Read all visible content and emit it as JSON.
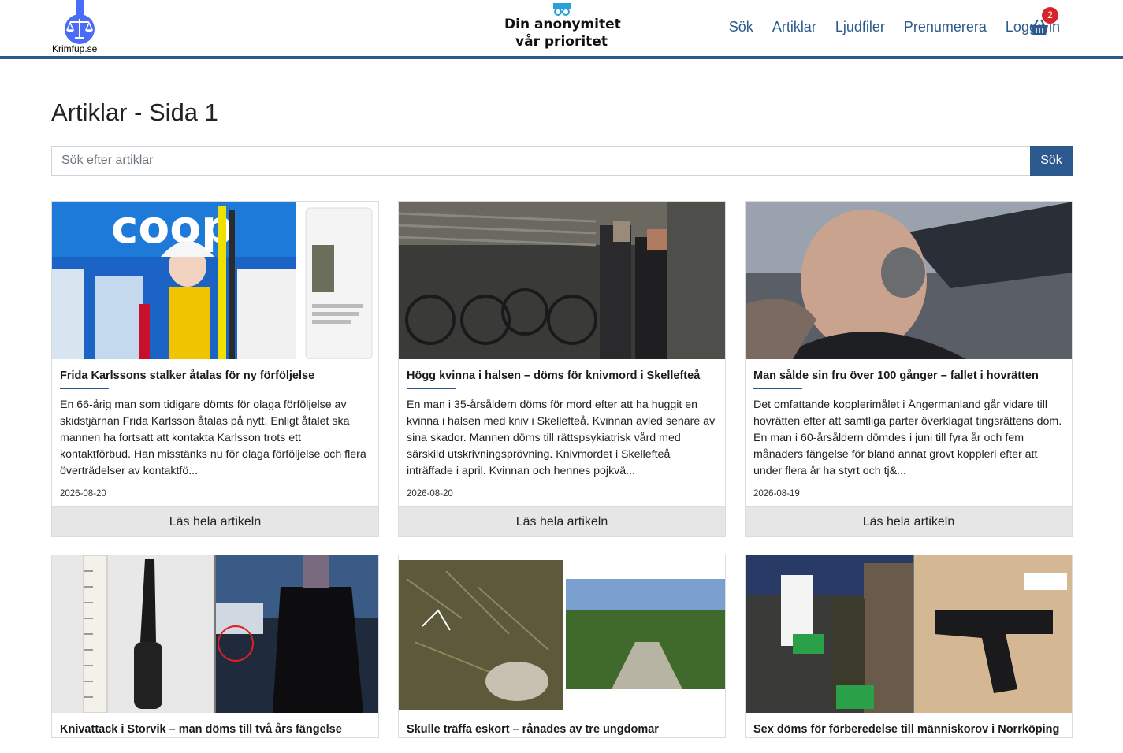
{
  "header": {
    "logo_text": "Krimfup.se",
    "slogan_line1": "Din anonymitet",
    "slogan_line2": "vår prioritet",
    "nav": [
      "Sök",
      "Artiklar",
      "Ljudfiler",
      "Prenumerera",
      "Logga in"
    ],
    "cart_count": "2",
    "accent_color": "#2d5a8e"
  },
  "page": {
    "title": "Artiklar - Sida 1",
    "search_placeholder": "Sök efter artiklar",
    "search_button": "Sök"
  },
  "articles": [
    {
      "title": "Frida Karlssons stalker åtalas för ny förföljelse",
      "excerpt": "En 66-årig man som tidigare dömts för olaga förföljelse av skidstjärnan Frida Karlsson åtalas på nytt. Enligt åtalet ska mannen ha fortsatt att kontakta Karlsson trots ett kontaktförbud. Han misstänks nu för olaga förföljelse och flera överträdelser av kontaktfö...",
      "date": "2026-08-20",
      "button": "Läs hela artikeln",
      "image_text": "coop"
    },
    {
      "title": "Högg kvinna i halsen – döms för knivmord i Skellefteå",
      "excerpt": "En man i 35-årsåldern döms för mord efter att ha huggit en kvinna i halsen med kniv i Skellefteå. Kvinnan avled senare av sina skador. Mannen döms till rättspsykiatrisk vård med särskild utskrivningsprövning. Knivmordet i Skellefteå inträffade i april. Kvinnan och hennes pojkvä...",
      "date": "2026-08-20",
      "button": "Läs hela artikeln"
    },
    {
      "title": "Man sålde sin fru över 100 gånger – fallet i hovrätten",
      "excerpt": "Det omfattande kopplerimålet i Ångermanland går vidare till hovrätten efter att samtliga parter överklagat tingsrättens dom. En man i 60-årsåldern dömdes i juni till fyra år och fem månaders fängelse för bland annat grovt koppleri efter att under flera år ha styrt och tj&...",
      "date": "2026-08-19",
      "button": "Läs hela artikeln"
    },
    {
      "title": "Knivattack i Storvik – man döms till två års fängelse"
    },
    {
      "title": "Skulle träffa eskort – rånades av tre ungdomar"
    },
    {
      "title": "Sex döms för förberedelse till människorov i Norrköping"
    }
  ]
}
